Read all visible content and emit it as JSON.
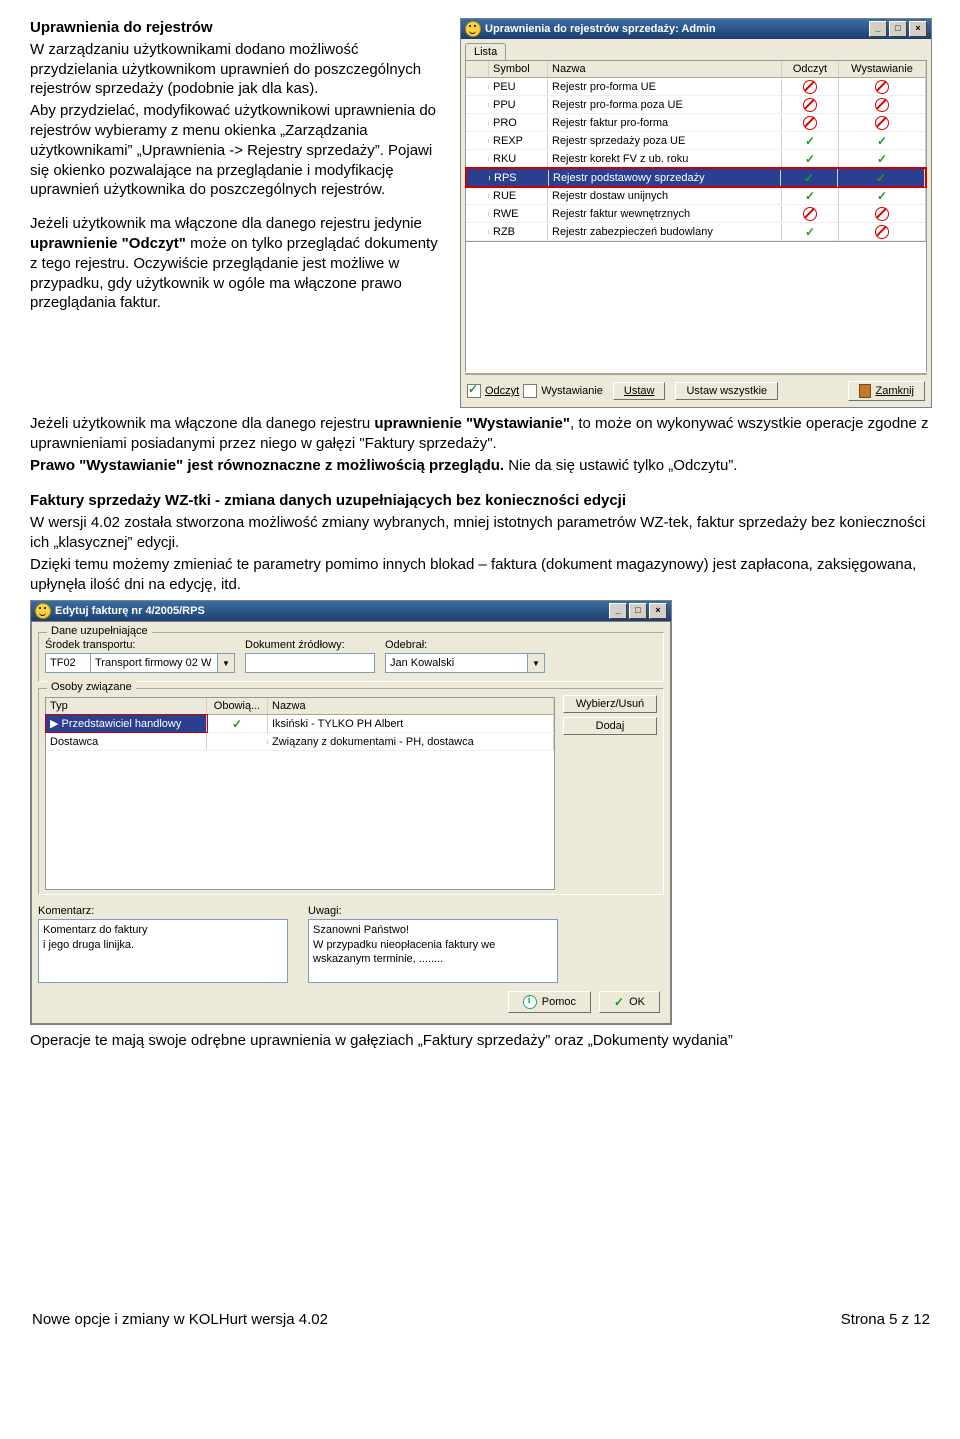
{
  "section1": {
    "heading": "Uprawnienia do rejestrów",
    "p1": "W zarządzaniu użytkownikami dodano możliwość przydzielania użytkownikom uprawnień do poszczególnych rejestrów sprzedaży (podobnie jak dla kas).",
    "p2": "Aby przydzielać, modyfikować użytkownikowi uprawnienia do rejestrów wybieramy z menu okienka „Zarządzania użytkownikami” „Uprawnienia -> Rejestry sprzedaży”. Pojawi się okienko pozwalające na przeglądanie i modyfikację uprawnień użytkownika do poszczególnych rejestrów.",
    "p3a": "Jeżeli użytkownik ma włączone dla danego rejestru jedynie ",
    "p3b": "uprawnienie \"Odczyt\"",
    "p3c": " może on tylko przeglądać dokumenty z tego rejestru. Oczywiście przeglądanie jest możliwe w przypadku, gdy użytkownik w ogóle ma włączone prawo przeglądania faktur.",
    "p4a": "Jeżeli użytkownik ma włączone dla danego rejestru ",
    "p4b": "uprawnienie \"Wystawianie\"",
    "p4c": ", to może on wykonywać wszystkie operacje zgodne z uprawnieniami posiadanymi przez niego w gałęzi \"Faktury sprzedaży\".",
    "p5a": "Prawo \"Wystawianie\" jest równoznaczne z możliwością przeglądu.",
    "p5b": " Nie da się ustawić tylko „Odczytu”."
  },
  "win1": {
    "title": "Uprawnienia do rejestrów sprzedaży: Admin",
    "tab": "Lista",
    "headers": {
      "sym": "Symbol",
      "naz": "Nazwa",
      "od": "Odczyt",
      "wy": "Wystawianie"
    },
    "rows": [
      {
        "sym": "PEU",
        "naz": "Rejestr pro-forma UE",
        "od": "deny",
        "wy": "deny"
      },
      {
        "sym": "PPU",
        "naz": "Rejestr pro-forma poza UE",
        "od": "deny",
        "wy": "deny"
      },
      {
        "sym": "PRO",
        "naz": "Rejestr faktur pro-forma",
        "od": "deny",
        "wy": "deny"
      },
      {
        "sym": "REXP",
        "naz": "Rejestr sprzedaży poza UE",
        "od": "chk",
        "wy": "chk"
      },
      {
        "sym": "RKU",
        "naz": "Rejestr korekt FV z ub. roku",
        "od": "chk",
        "wy": "chk"
      },
      {
        "sym": "RPS",
        "naz": "Rejestr podstawowy sprzedaży",
        "od": "chk",
        "wy": "chk",
        "sel": true
      },
      {
        "sym": "RUE",
        "naz": "Rejestr dostaw unijnych",
        "od": "chk",
        "wy": "chk"
      },
      {
        "sym": "RWE",
        "naz": "Rejestr faktur wewnętrznych",
        "od": "deny",
        "wy": "deny"
      },
      {
        "sym": "RZB",
        "naz": "Rejestr zabezpieczeń budowlany",
        "od": "chk",
        "wy": "deny"
      }
    ],
    "bottom": {
      "odczyt": "Odczyt",
      "wyst": "Wystawianie",
      "ustaw": "Ustaw",
      "ustaw_w": "Ustaw wszystkie",
      "zamknij": "Zamknij"
    }
  },
  "section2": {
    "heading": "Faktury sprzedaży WZ-tki - zmiana danych uzupełniających bez konieczności edycji",
    "p1": "W wersji 4.02 została stworzona możliwość zmiany wybranych, mniej istotnych parametrów WZ-tek, faktur sprzedaży bez konieczności ich „klasycznej” edycji.",
    "p2": "Dzięki temu możemy zmieniać te parametry pomimo innych blokad – faktura (dokument magazynowy) jest zapłacona, zaksięgowana, upłynęła ilość dni na edycję, itd."
  },
  "win2": {
    "title": "Edytuj fakturę nr 4/2005/RPS",
    "group1": "Dane uzupełniające",
    "lbl_srodek": "Środek transportu:",
    "srodek_code": "TF02",
    "srodek_name": "Transport firmowy 02 W",
    "lbl_dok": "Dokument źródłowy:",
    "dok_val": "",
    "lbl_odebral": "Odebrał:",
    "odebral_val": "Jan Kowalski",
    "group2": "Osoby związane",
    "g2headers": {
      "typ": "Typ",
      "ob": "Obowią...",
      "naz": "Nazwa"
    },
    "g2rows": [
      {
        "typ": "Przedstawiciel handlowy",
        "ob": "chk",
        "naz": "Iksiński - TYLKO PH Albert",
        "sel": true
      },
      {
        "typ": "Dostawca",
        "ob": "",
        "naz": "Związany z dokumentami - PH, dostawca"
      }
    ],
    "btn_wybierz": "Wybierz/Usuń",
    "btn_dodaj": "Dodaj",
    "lbl_kom": "Komentarz:",
    "kom_val": "Komentarz do faktury\ni jego druga linijka.",
    "lbl_uwagi": "Uwagi:",
    "uwagi_val": "Szanowni Państwo!\nW przypadku nieopłacenia faktury we wskazanym terminie, ........",
    "btn_pomoc": "Pomoc",
    "btn_ok": "OK"
  },
  "section3": {
    "p": "Operacje te mają swoje odrębne uprawnienia w gałęziach „Faktury sprzedaży” oraz „Dokumenty wydania”"
  },
  "footer": {
    "left": "Nowe opcje i zmiany w KOLHurt wersja 4.02",
    "right": "Strona 5 z 12"
  }
}
